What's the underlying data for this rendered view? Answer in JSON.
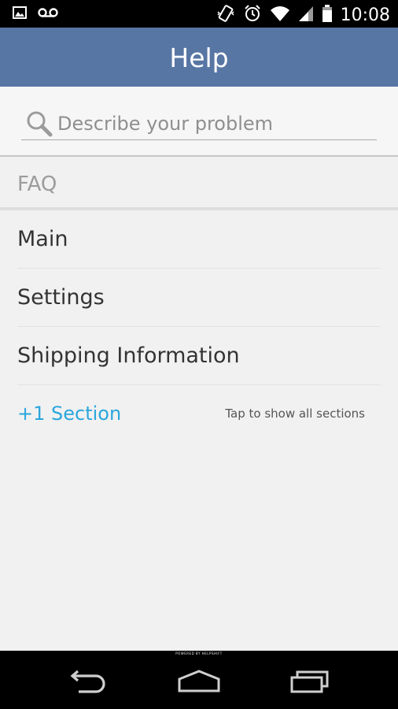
{
  "status_bar": {
    "time": "10:08",
    "icons": [
      "image-notification-icon",
      "voicemail-icon",
      "vibrate-icon",
      "alarm-icon",
      "wifi-icon",
      "signal-icon",
      "battery-icon"
    ]
  },
  "action_bar": {
    "title": "Help"
  },
  "search": {
    "placeholder": "Describe your problem",
    "value": ""
  },
  "faq": {
    "header": "FAQ",
    "items": [
      {
        "label": "Main"
      },
      {
        "label": "Settings"
      },
      {
        "label": "Shipping Information"
      }
    ],
    "more": {
      "label": "+1 Section",
      "hint": "Tap to show all sections"
    }
  },
  "footer": {
    "powered_by": "POWERED BY HELPSHIFT"
  },
  "nav_bar": {
    "buttons": [
      "back-icon",
      "home-icon",
      "recents-icon"
    ]
  },
  "colors": {
    "action_bar": "#5876a4",
    "accent": "#2aa6dc",
    "background": "#f1f1f1"
  }
}
